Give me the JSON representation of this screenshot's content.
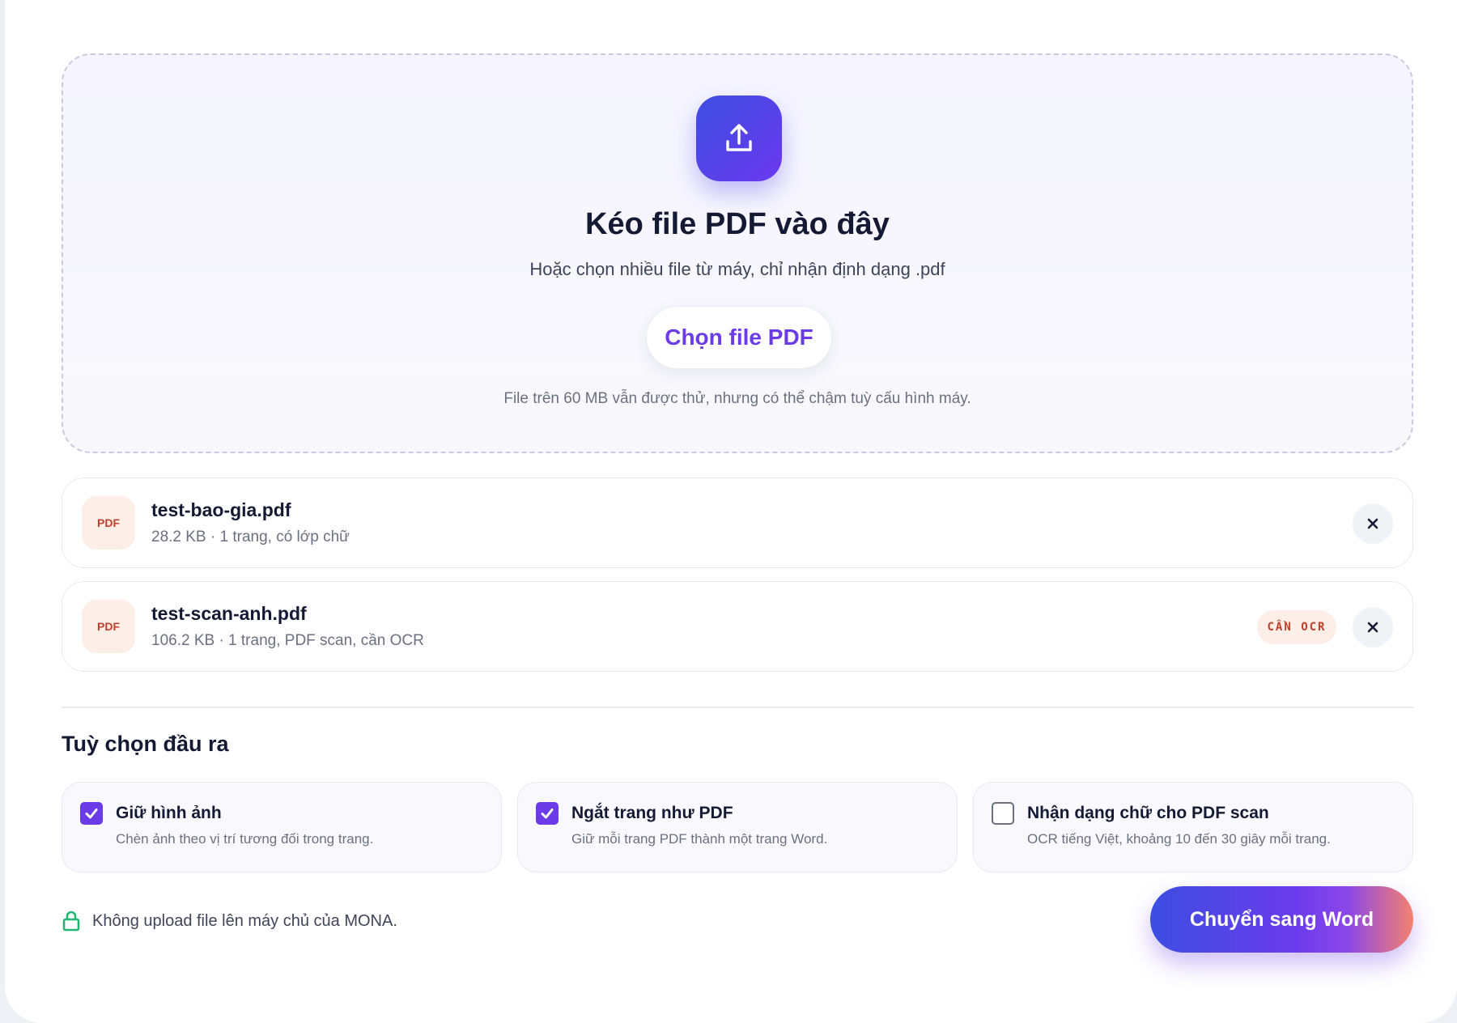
{
  "dropzone": {
    "title": "Kéo file PDF vào đây",
    "subtitle": "Hoặc chọn nhiều file từ máy, chỉ nhận định dạng .pdf",
    "button_label": "Chọn file PDF",
    "note": "File trên 60 MB vẫn được thử, nhưng có thể chậm tuỳ cấu hình máy."
  },
  "files": [
    {
      "badge": "PDF",
      "name": "test-bao-gia.pdf",
      "meta": "28.2 KB · 1 trang, có lớp chữ",
      "tag": ""
    },
    {
      "badge": "PDF",
      "name": "test-scan-anh.pdf",
      "meta": "106.2 KB · 1 trang, PDF scan, cần OCR",
      "tag": "CẦN OCR"
    }
  ],
  "options": {
    "title": "Tuỳ chọn đầu ra",
    "items": [
      {
        "title": "Giữ hình ảnh",
        "desc": "Chèn ảnh theo vị trí tương đối trong trang.",
        "checked": true
      },
      {
        "title": "Ngắt trang như PDF",
        "desc": "Giữ mỗi trang PDF thành một trang Word.",
        "checked": true
      },
      {
        "title": "Nhận dạng chữ cho PDF scan",
        "desc": "OCR tiếng Việt, khoảng 10 đến 30 giây mỗi trang.",
        "checked": false
      }
    ]
  },
  "footer": {
    "privacy_text": "Không upload file lên máy chủ của MONA.",
    "convert_label": "Chuyển sang Word"
  },
  "colors": {
    "accent": "#6b3be8",
    "accent_blue": "#3d4fe0",
    "ocr_tag": "#c0402b",
    "lock_icon": "#22b573"
  },
  "icons": {
    "upload": "upload-icon",
    "remove": "close-icon",
    "check": "check-icon",
    "privacy": "lock-icon"
  }
}
